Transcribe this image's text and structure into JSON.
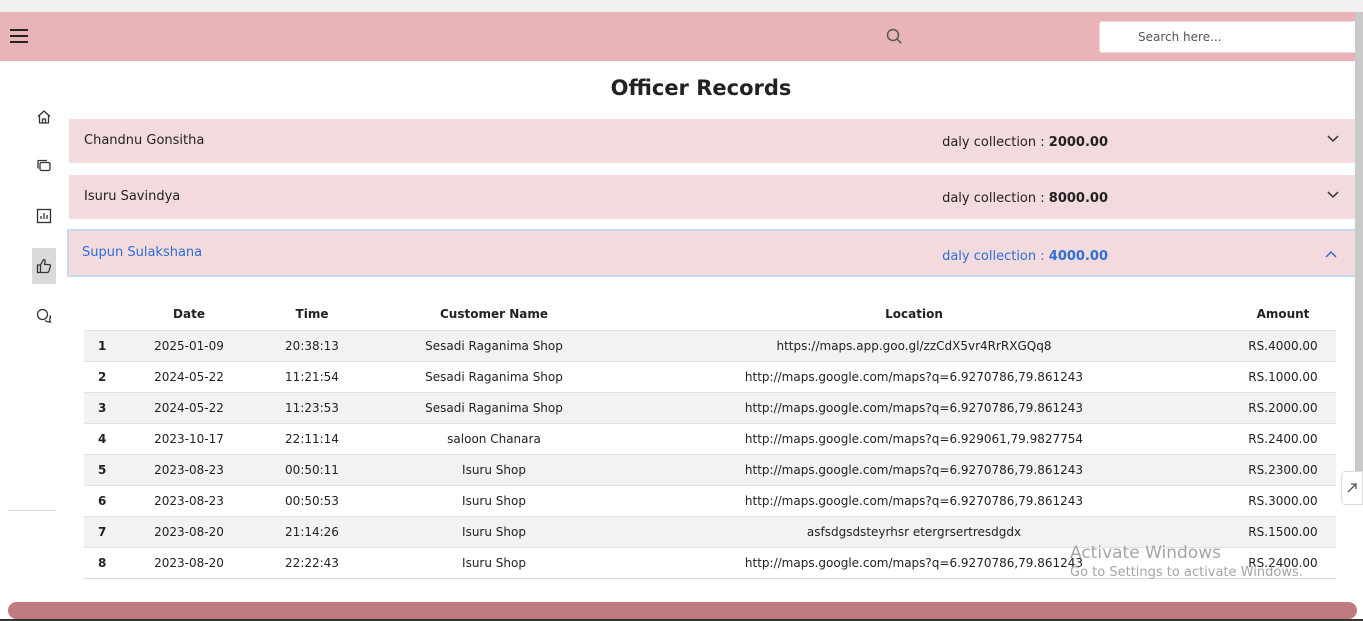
{
  "header": {
    "search_placeholder": "Search here..."
  },
  "page": {
    "title": "Officer Records"
  },
  "officers": [
    {
      "name": "Chandnu Gonsitha",
      "collection_label": "daly collection : ",
      "collection_value": "2000.00"
    },
    {
      "name": "Isuru Savindya",
      "collection_label": "daly collection : ",
      "collection_value": "8000.00"
    },
    {
      "name": "Supun Sulakshana",
      "collection_label": "daly collection : ",
      "collection_value": "4000.00"
    }
  ],
  "table": {
    "headers": [
      "",
      "Date",
      "Time",
      "Customer Name",
      "Location",
      "Amount"
    ],
    "rows": [
      [
        "1",
        "2025-01-09",
        "20:38:13",
        "Sesadi Raganima Shop",
        "https://maps.app.goo.gl/zzCdX5vr4RrRXGQq8",
        "RS.4000.00"
      ],
      [
        "2",
        "2024-05-22",
        "11:21:54",
        "Sesadi Raganima Shop",
        "http://maps.google.com/maps?q=6.9270786,79.861243",
        "RS.1000.00"
      ],
      [
        "3",
        "2024-05-22",
        "11:23:53",
        "Sesadi Raganima Shop",
        "http://maps.google.com/maps?q=6.9270786,79.861243",
        "RS.2000.00"
      ],
      [
        "4",
        "2023-10-17",
        "22:11:14",
        "saloon Chanara",
        "http://maps.google.com/maps?q=6.929061,79.9827754",
        "RS.2400.00"
      ],
      [
        "5",
        "2023-08-23",
        "00:50:11",
        "Isuru Shop",
        "http://maps.google.com/maps?q=6.9270786,79.861243",
        "RS.2300.00"
      ],
      [
        "6",
        "2023-08-23",
        "00:50:53",
        "Isuru Shop",
        "http://maps.google.com/maps?q=6.9270786,79.861243",
        "RS.3000.00"
      ],
      [
        "7",
        "2023-08-20",
        "21:14:26",
        "Isuru Shop",
        "asfsdgsdsteyrhsr etergrsertresdgdx",
        "RS.1500.00"
      ],
      [
        "8",
        "2023-08-20",
        "22:22:43",
        "Isuru Shop",
        "http://maps.google.com/maps?q=6.9270786,79.861243",
        "RS.2400.00"
      ]
    ]
  },
  "watermark": {
    "line1": "Activate Windows",
    "line2": "Go to Settings to activate Windows."
  },
  "colors": {
    "header_bg": "#e8b4b7",
    "accordion_bg": "#f3dadc",
    "active_text": "#2e6fd8",
    "scrollbar": "#bf7a80"
  },
  "icons": {
    "menu": "hamburger-menu-icon",
    "search": "search-icon",
    "home": "home-icon",
    "records": "layers-icon",
    "reports": "bar-chart-icon",
    "approvals": "thumbs-up-icon",
    "chat": "chat-bubbles-icon",
    "collapse": "chevron-down-icon",
    "expand": "chevron-up-icon"
  }
}
